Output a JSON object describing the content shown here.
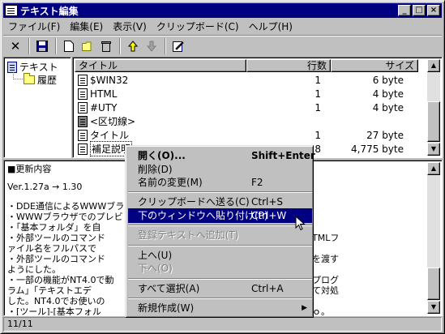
{
  "window": {
    "title": "テキスト編集",
    "min": "_",
    "max": "□",
    "close": "×"
  },
  "menu": [
    "ファイル(F)",
    "編集(E)",
    "表示(V)",
    "クリップボード(C)",
    "ヘルプ(H)"
  ],
  "tree": {
    "root": "テキスト",
    "child": "履歴"
  },
  "list": {
    "headers": [
      "タイトル",
      "行数",
      "サイズ"
    ],
    "rows": [
      {
        "title": "$WIN32",
        "lines": "1",
        "size": "6 byte"
      },
      {
        "title": "HTML",
        "lines": "1",
        "size": "4 byte"
      },
      {
        "title": "#UTY",
        "lines": "1",
        "size": "4 byte"
      },
      {
        "title": "<区切線>",
        "lines": "",
        "size": ""
      },
      {
        "title": "タイトル",
        "lines": "1",
        "size": "27 byte"
      },
      {
        "title": "補足説明",
        "lines": "118",
        "size": "4,775 byte"
      }
    ]
  },
  "editor": {
    "lines": [
      "■更新内容",
      "",
      "Ver.1.27a → 1.30",
      "",
      "・DDE通信によるWWWブラ",
      "・WWWブラウザでのプレビ",
      "・「基本フォルダ」を自",
      "・外部ツールのコマンド",
      "  ァイル名をフルパスで",
      "・外部ツールのコマンド",
      "  ようにした。",
      "・一部の機能がNT4.0で動",
      "  ラム」「テキストエデ",
      "  した。NT4.0でお使いの",
      "・[ツール]-[基本フォル"
    ],
    "right_fragments": [
      "TMLフ",
      "を渡す",
      "プログ",
      "て対処",
      "ｏ。"
    ]
  },
  "status": "11/11",
  "context_menu": [
    {
      "label": "開く(O)...",
      "shortcut": "Shift+Enter",
      "bold": true
    },
    {
      "label": "削除(D)",
      "shortcut": ""
    },
    {
      "label": "名前の変更(M)",
      "shortcut": "F2"
    },
    {
      "sep": true
    },
    {
      "label": "クリップボードへ送る(C)",
      "shortcut": "Ctrl+S"
    },
    {
      "label": "下のウィンドウへ貼り付け(P)",
      "shortcut": "Ctrl+W",
      "highlight": true
    },
    {
      "sep": true
    },
    {
      "label": "登録テキストへ追加(T)",
      "shortcut": "",
      "disabled": true
    },
    {
      "sep": true
    },
    {
      "label": "上へ(U)",
      "shortcut": ""
    },
    {
      "label": "下へ(O)",
      "shortcut": "",
      "disabled": true
    },
    {
      "sep": true
    },
    {
      "label": "すべて選択(A)",
      "shortcut": "Ctrl+A"
    },
    {
      "sep": true
    },
    {
      "label": "新規作成(W)",
      "shortcut": "",
      "submenu": true
    }
  ]
}
